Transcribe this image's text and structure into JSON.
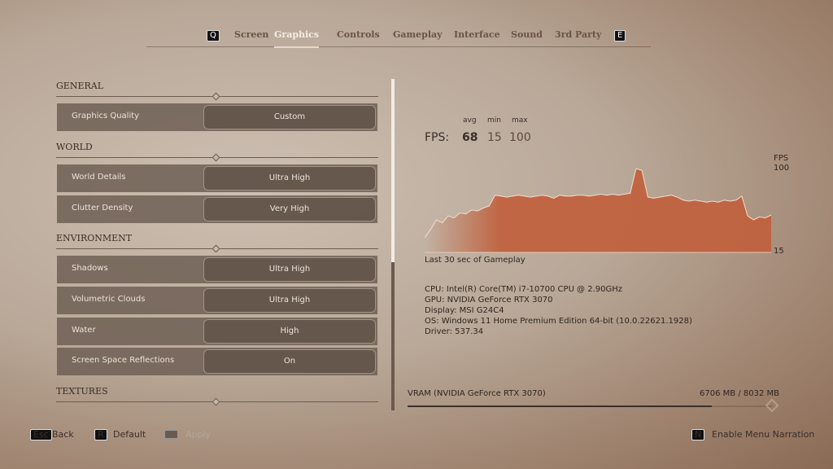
{
  "tabs": {
    "prev_key": "Q",
    "next_key": "E",
    "items": [
      "Screen",
      "Graphics",
      "Controls",
      "Gameplay",
      "Interface",
      "Sound",
      "3rd Party"
    ],
    "active": "Graphics"
  },
  "settings": {
    "sections": [
      {
        "title": "GENERAL",
        "rows": [
          {
            "label": "Graphics Quality",
            "value": "Custom"
          }
        ]
      },
      {
        "title": "WORLD",
        "rows": [
          {
            "label": "World Details",
            "value": "Ultra High"
          },
          {
            "label": "Clutter Density",
            "value": "Very High"
          }
        ]
      },
      {
        "title": "ENVIRONMENT",
        "rows": [
          {
            "label": "Shadows",
            "value": "Ultra High"
          },
          {
            "label": "Volumetric Clouds",
            "value": "Ultra High"
          },
          {
            "label": "Water",
            "value": "High"
          },
          {
            "label": "Screen Space Reflections",
            "value": "On"
          }
        ]
      },
      {
        "title": "TEXTURES",
        "rows": []
      }
    ]
  },
  "fps": {
    "label": "FPS:",
    "avg_label": "avg",
    "min_label": "min",
    "max_label": "max",
    "avg": "68",
    "min": "15",
    "max": "100"
  },
  "chart_data": {
    "type": "area",
    "title": "",
    "xlabel": "Last 30 sec of Gameplay",
    "ylabel": "FPS",
    "y_top_label": "100",
    "y_bottom_label": "15",
    "ylim": [
      15,
      100
    ],
    "x_seconds": 30,
    "color": "#c0623f",
    "values": [
      30,
      38,
      48,
      45,
      52,
      50,
      55,
      54,
      58,
      57,
      60,
      62,
      73,
      72,
      71,
      72,
      73,
      72,
      71,
      72,
      73,
      72,
      70,
      73,
      72,
      72,
      73,
      73,
      72,
      73,
      74,
      73,
      74,
      73,
      74,
      75,
      100,
      98,
      71,
      70,
      71,
      72,
      73,
      71,
      68,
      67,
      68,
      67,
      66,
      67,
      66,
      68,
      67,
      68,
      72,
      52,
      48,
      51,
      50,
      53
    ]
  },
  "system": {
    "cpu": "CPU: Intel(R) Core(TM) i7-10700 CPU @ 2.90GHz",
    "gpu": "GPU: NVIDIA GeForce RTX 3070",
    "display": "Display: MSI G24C4",
    "os": "OS: Windows 11 Home Premium Edition 64-bit (10.0.22621.1928)",
    "driver": "Driver: 537.34"
  },
  "vram": {
    "label": "VRAM (NVIDIA GeForce RTX 3070)",
    "usage": "6706 MB / 8032 MB",
    "used_mb": 6706,
    "total_mb": 8032
  },
  "footer": {
    "back_key": "Esc",
    "back": "Back",
    "default_key": "R",
    "default": "Default",
    "apply": "Apply",
    "narration_key": "N",
    "narration": "Enable Menu Narration"
  }
}
